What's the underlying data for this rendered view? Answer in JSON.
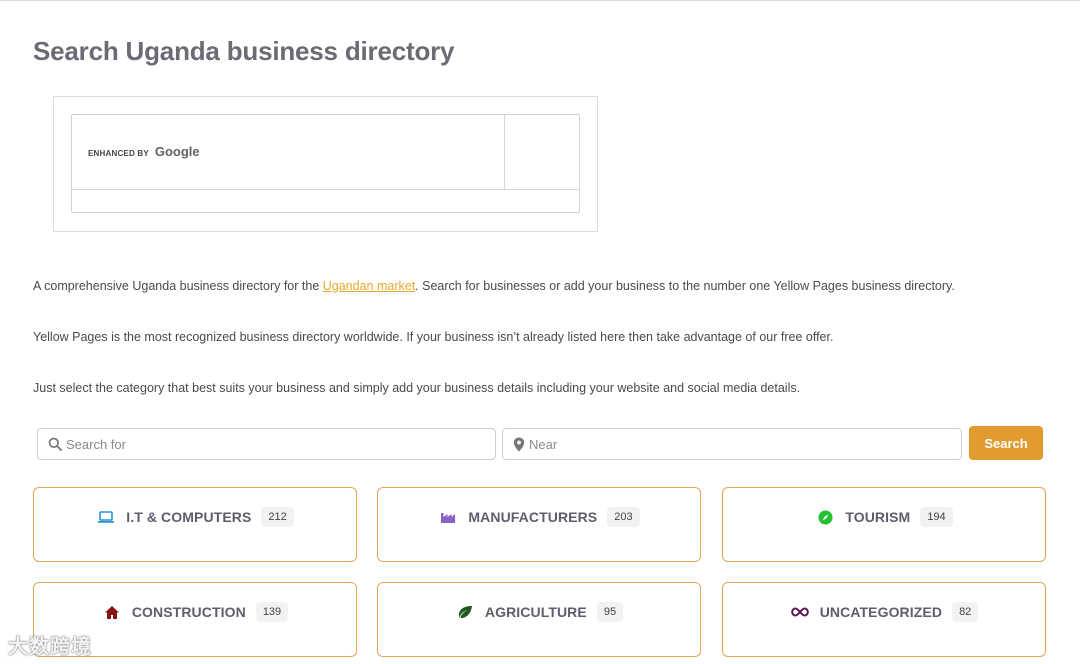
{
  "page": {
    "title": "Search Uganda business directory"
  },
  "google_search": {
    "enhanced_by": "ENHANCED BY",
    "brand": "Google"
  },
  "intro": {
    "p1_before": "A comprehensive Uganda business directory for the ",
    "p1_link": "Ugandan market",
    "p1_after": ". Search for businesses or add your business to the number one Yellow Pages business directory.",
    "p2": "Yellow Pages is the most recognized business directory worldwide. If your business isn’t already listed here then take advantage of our free offer.",
    "p3": "Just select the category that best suits your business and simply add your business details including your website and social media details."
  },
  "search_form": {
    "search_placeholder": "Search for",
    "near_placeholder": "Near",
    "button_label": "Search",
    "accent_color": "#e29b2f"
  },
  "categories": [
    {
      "label": "I.T & COMPUTERS",
      "count": "212",
      "icon": "laptop-icon",
      "icon_color": "#2b8fd6"
    },
    {
      "label": "MANUFACTURERS",
      "count": "203",
      "icon": "factory-icon",
      "icon_color": "#8e5fc7"
    },
    {
      "label": "TOURISM",
      "count": "194",
      "icon": "compass-icon",
      "icon_color": "#22c12e"
    },
    {
      "label": "CONSTRUCTION",
      "count": "139",
      "icon": "house-icon",
      "icon_color": "#8b1414"
    },
    {
      "label": "AGRICULTURE",
      "count": "95",
      "icon": "leaf-icon",
      "icon_color": "#1f5a1f"
    },
    {
      "label": "UNCATEGORIZED",
      "count": "82",
      "icon": "infinity-icon",
      "icon_color": "#5a1450"
    }
  ],
  "watermark": {
    "text": "大数跨境"
  }
}
